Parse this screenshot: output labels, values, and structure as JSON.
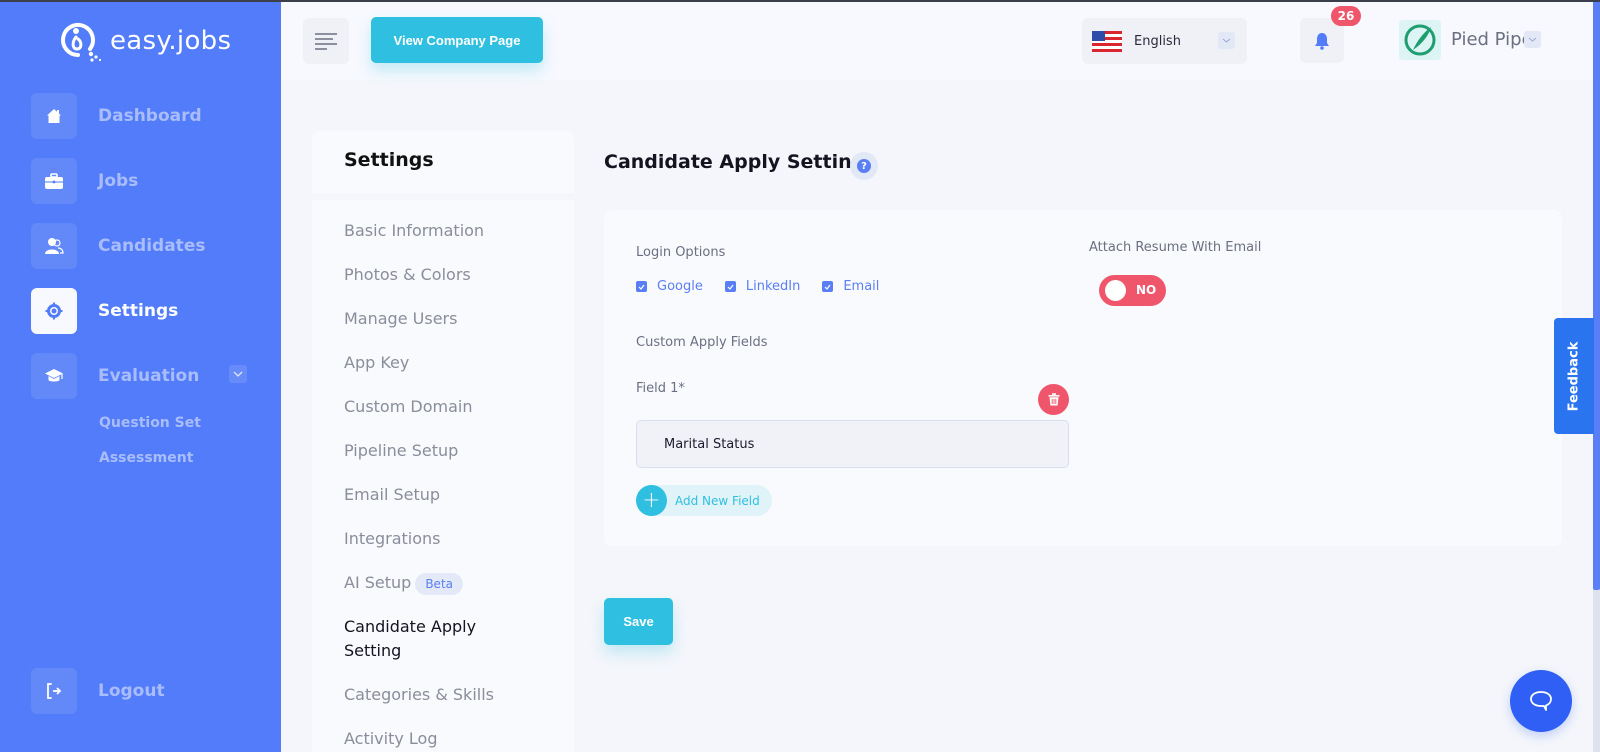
{
  "brand": {
    "name": "easy.jobs"
  },
  "sidebar": {
    "items": [
      {
        "label": "Dashboard",
        "icon": "home-icon",
        "active": false
      },
      {
        "label": "Jobs",
        "icon": "briefcase-icon",
        "active": false
      },
      {
        "label": "Candidates",
        "icon": "users-icon",
        "active": false
      },
      {
        "label": "Settings",
        "icon": "gear-icon",
        "active": true
      },
      {
        "label": "Evaluation",
        "icon": "graduation-cap-icon",
        "active": false
      }
    ],
    "evaluation_subitems": [
      {
        "label": "Question Set"
      },
      {
        "label": "Assessment"
      }
    ],
    "logout": {
      "label": "Logout",
      "icon": "logout-icon"
    }
  },
  "header": {
    "view_company_label": "View Company Page",
    "language": {
      "selected": "English",
      "flag": "us-flag-icon"
    },
    "notifications": {
      "count": "26"
    },
    "company": {
      "name": "Pied Pipe"
    }
  },
  "settings_nav": {
    "title": "Settings",
    "items": [
      {
        "label": "Basic Information"
      },
      {
        "label": "Photos & Colors"
      },
      {
        "label": "Manage Users"
      },
      {
        "label": "App Key"
      },
      {
        "label": "Custom Domain"
      },
      {
        "label": "Pipeline Setup"
      },
      {
        "label": "Email Setup"
      },
      {
        "label": "Integrations"
      },
      {
        "label": "AI Setup",
        "badge": "Beta"
      },
      {
        "label": "Candidate Apply Setting",
        "active": true
      },
      {
        "label": "Categories & Skills"
      },
      {
        "label": "Activity Log"
      }
    ]
  },
  "main": {
    "title": "Candidate Apply Setting",
    "login_options": {
      "label": "Login Options",
      "options": [
        {
          "label": "Google",
          "checked": true
        },
        {
          "label": "LinkedIn",
          "checked": true
        },
        {
          "label": "Email",
          "checked": true
        }
      ]
    },
    "attach_resume": {
      "label": "Attach Resume With Email",
      "value": "NO",
      "enabled": false
    },
    "custom_fields": {
      "label": "Custom Apply Fields",
      "fields": [
        {
          "label": "Field 1*",
          "value": "Marital Status"
        }
      ],
      "add_label": "Add New Field"
    },
    "save_label": "Save"
  },
  "widgets": {
    "feedback_label": "Feedback"
  },
  "colors": {
    "sidebar": "#527cf9",
    "accent_cyan": "#2fbfe0",
    "danger": "#f0566b",
    "primary": "#5a7ef5"
  }
}
